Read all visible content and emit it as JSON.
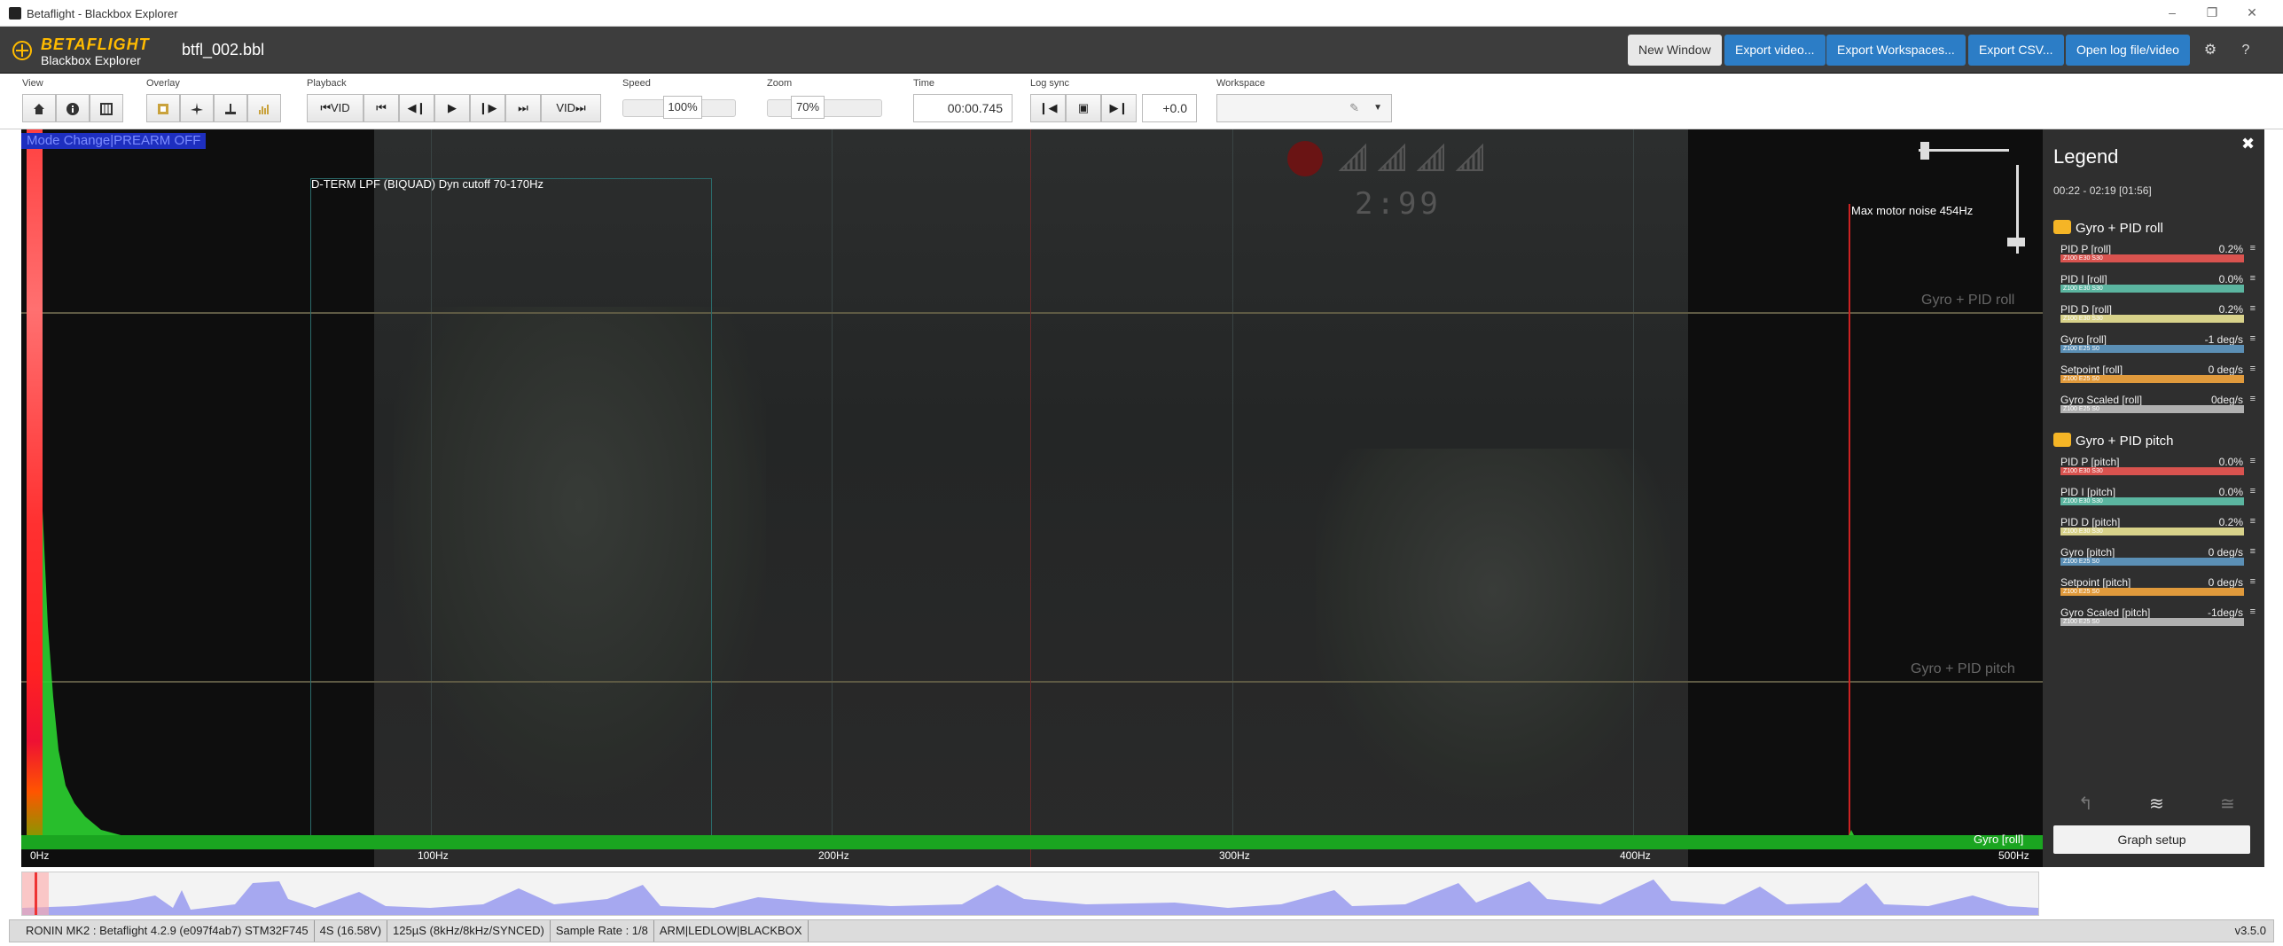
{
  "window": {
    "title": "Betaflight - Blackbox Explorer"
  },
  "header": {
    "logo_brand": "BETAFLIGHT",
    "logo_sub": "Blackbox Explorer",
    "filename": "btfl_002.bbl",
    "buttons": {
      "new_window": "New Window",
      "export_video": "Export video...",
      "export_workspaces": "Export Workspaces...",
      "export_csv": "Export CSV...",
      "open_log": "Open log file/video"
    },
    "icons": [
      "gear-icon",
      "help-icon"
    ]
  },
  "toolbar": {
    "view_label": "View",
    "overlay_label": "Overlay",
    "playback_label": "Playback",
    "speed_label": "Speed",
    "zoom_label": "Zoom",
    "time_label": "Time",
    "logsync_label": "Log sync",
    "workspace_label": "Workspace",
    "vid_back": "VID",
    "vid_forward": "VID",
    "speed_value": "100%",
    "zoom_value": "70%",
    "time_value": "00:00.745",
    "sync_value": "+0.0"
  },
  "graph": {
    "mode_change": "Mode Change|PREARM OFF",
    "filter_label": "D-TERM LPF (BIQUAD) Dyn cutoff 70-170Hz",
    "motor_noise_label": "Max motor noise 454Hz",
    "osd_time": "2:99",
    "series_title_1": "Gyro + PID roll",
    "series_title_2": "Gyro + PID pitch",
    "current_series": "Gyro [roll]",
    "axis_ticks": [
      "0Hz",
      "100Hz",
      "200Hz",
      "300Hz",
      "400Hz",
      "500Hz"
    ]
  },
  "legend": {
    "title": "Legend",
    "range": "00:22 - 02:19 [01:56]",
    "groups": [
      {
        "name": "Gyro + PID roll",
        "items": [
          {
            "name": "PID P [roll]",
            "value": "0.2%",
            "bar_text": "Z100 E30 S30",
            "color": "#d9534f"
          },
          {
            "name": "PID I [roll]",
            "value": "0.0%",
            "bar_text": "Z100 E30 S30",
            "color": "#5bb5a0"
          },
          {
            "name": "PID D [roll]",
            "value": "0.2%",
            "bar_text": "Z100 E30 S30",
            "color": "#d8d28a"
          },
          {
            "name": "Gyro [roll]",
            "value": "-1 deg/s",
            "bar_text": "Z100 E25 S0",
            "color": "#5b8fb5"
          },
          {
            "name": "Setpoint [roll]",
            "value": "0 deg/s",
            "bar_text": "Z100 E25 S0",
            "color": "#e09a3c"
          },
          {
            "name": "Gyro Scaled [roll]",
            "value": "0deg/s",
            "bar_text": "Z100 E25 S0",
            "color": "#b0b0b0"
          }
        ]
      },
      {
        "name": "Gyro + PID pitch",
        "items": [
          {
            "name": "PID P [pitch]",
            "value": "0.0%",
            "bar_text": "Z100 E30 S30",
            "color": "#d9534f"
          },
          {
            "name": "PID I [pitch]",
            "value": "0.0%",
            "bar_text": "Z100 E30 S30",
            "color": "#5bb5a0"
          },
          {
            "name": "PID D [pitch]",
            "value": "0.2%",
            "bar_text": "Z100 E30 S30",
            "color": "#d8d28a"
          },
          {
            "name": "Gyro [pitch]",
            "value": "0 deg/s",
            "bar_text": "Z100 E25 S0",
            "color": "#5b8fb5"
          },
          {
            "name": "Setpoint [pitch]",
            "value": "0 deg/s",
            "bar_text": "Z100 E25 S0",
            "color": "#e09a3c"
          },
          {
            "name": "Gyro Scaled [pitch]",
            "value": "-1deg/s",
            "bar_text": "Z100 E25 S0",
            "color": "#b0b0b0"
          }
        ]
      }
    ],
    "graph_setup": "Graph setup"
  },
  "status": {
    "segments": [
      "RONIN MK2 : Betaflight 4.2.9 (e097f4ab7) STM32F745",
      "4S (16.58V)",
      "125µS (8kHz/8kHz/SYNCED)",
      "Sample Rate : 1/8",
      "ARM|LEDLOW|BLACKBOX"
    ],
    "version": "v3.5.0"
  }
}
